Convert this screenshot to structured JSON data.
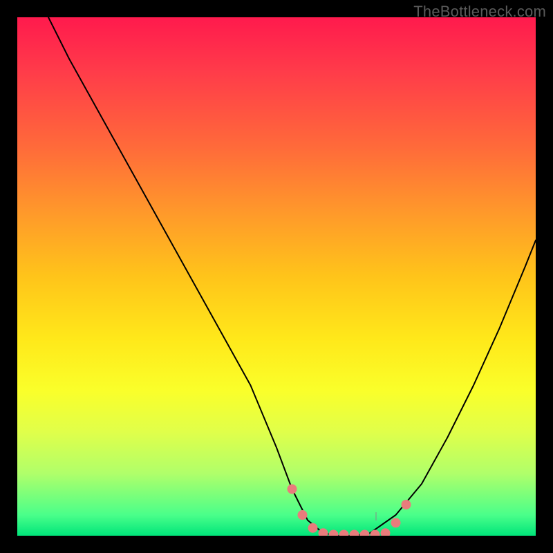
{
  "chart_data": {
    "type": "line",
    "title": "",
    "xlabel": "",
    "ylabel": "",
    "xlim": [
      0,
      100
    ],
    "ylim": [
      0,
      100
    ],
    "series": [
      {
        "name": "bottleneck-curve",
        "x": [
          6,
          10,
          15,
          20,
          25,
          30,
          35,
          40,
          45,
          50,
          53,
          56,
          59,
          62,
          65,
          68,
          73,
          78,
          83,
          88,
          93,
          98,
          100
        ],
        "values": [
          100,
          92,
          83,
          74,
          65,
          56,
          47,
          38,
          29,
          17,
          9,
          3,
          0.5,
          0,
          0,
          0.5,
          4,
          10,
          19,
          29,
          40,
          52,
          57
        ]
      }
    ],
    "markers": {
      "name": "highlight-dots",
      "color": "#e97c7c",
      "points": [
        {
          "x": 53,
          "y": 9
        },
        {
          "x": 55,
          "y": 4
        },
        {
          "x": 57,
          "y": 1.5
        },
        {
          "x": 59,
          "y": 0.5
        },
        {
          "x": 61,
          "y": 0.2
        },
        {
          "x": 63,
          "y": 0.2
        },
        {
          "x": 65,
          "y": 0.2
        },
        {
          "x": 67,
          "y": 0.2
        },
        {
          "x": 69,
          "y": 0.2
        },
        {
          "x": 71,
          "y": 0.5
        },
        {
          "x": 73,
          "y": 2.5
        },
        {
          "x": 75,
          "y": 6
        }
      ]
    },
    "attribution": "TheBottleneck.com"
  },
  "colors": {
    "frame": "#000000",
    "marker": "#e97c7c",
    "curve": "#000000",
    "attribution_text": "#5a5a5a"
  }
}
